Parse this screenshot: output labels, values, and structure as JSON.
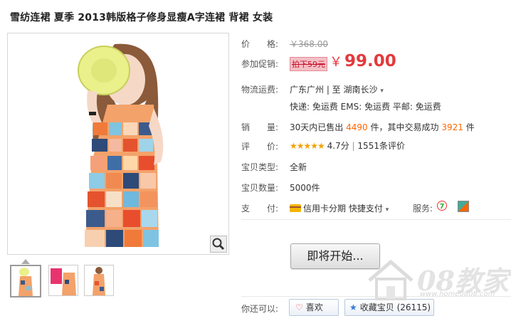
{
  "product": {
    "title": "雪纺连裙 夏季 2013韩版格子修身显瘦A字连裙 背裙 女装"
  },
  "details": {
    "price_label": "价　　格:",
    "original_price": "￥368.00",
    "promo_label": "参加促销:",
    "promo_tag": "拍下59元",
    "yen": "￥",
    "promo_price": "99.00",
    "shipping_label": "物流运费:",
    "shipping_route": "广东广州 | 至  湖南长沙",
    "shipping_fees": "快递: 免运费   EMS: 免运费   平邮: 免运费",
    "sales_label": "销　　量:",
    "sales_prefix": "30天内已售出",
    "sales_count": "4490",
    "sales_mid": "件，其中交易成功",
    "sales_success": "3921",
    "sales_suffix": "件",
    "rating_label": "评　　价:",
    "stars": "★★★★★",
    "rating": "4.7分",
    "rating_sep": "|",
    "reviews": "1551条评价",
    "type_label": "宝贝类型:",
    "type_value": "全新",
    "qty_label": "宝贝数量:",
    "qty_value": "5000件",
    "pay_label": "支　　付:",
    "pay_credit": "信用卡分期",
    "pay_quick": "快捷支付",
    "service_label": "服务:"
  },
  "actions": {
    "buy_label": "即将开始...",
    "also_label": "你还可以:",
    "like_label": "喜欢",
    "fav_label": "收藏宝贝 (26115)"
  },
  "watermark": {
    "brand": "08教家",
    "url": "www.home0808.com"
  },
  "colors": {
    "price_red": "#e4393c",
    "highlight_orange": "#ff6600",
    "star_gold": "#f2a100"
  }
}
